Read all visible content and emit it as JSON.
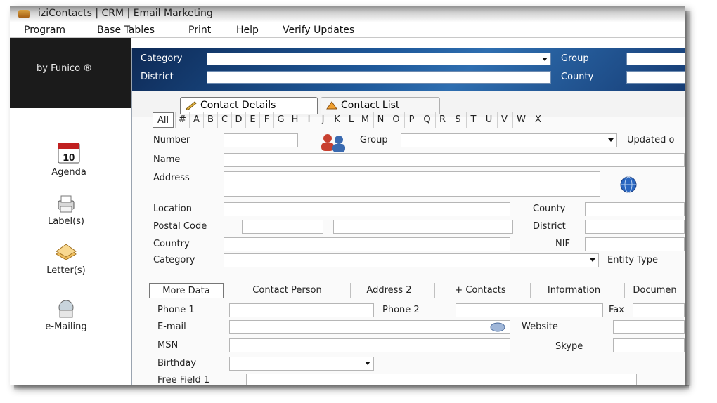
{
  "window": {
    "title": "iziContacts | CRM | Email Marketing"
  },
  "menu": [
    "Program",
    "Base Tables",
    "Print",
    "Help",
    "Verify Updates"
  ],
  "brand": "by Funico ®",
  "calendar_day": "10",
  "nav": [
    {
      "label": "Agenda",
      "icon": "calendar-icon"
    },
    {
      "label": "Label(s)",
      "icon": "label-printer-icon"
    },
    {
      "label": "Letter(s)",
      "icon": "letters-icon"
    },
    {
      "label": "e-Mailing",
      "icon": "mailing-icon"
    }
  ],
  "filters": {
    "category": "Category",
    "group": "Group",
    "district": "District",
    "county": "County"
  },
  "tabs": [
    "Contact Details",
    "Contact List"
  ],
  "alphabet": [
    "All",
    "#",
    "A",
    "B",
    "C",
    "D",
    "E",
    "F",
    "G",
    "H",
    "I",
    "J",
    "K",
    "L",
    "M",
    "N",
    "O",
    "P",
    "Q",
    "R",
    "S",
    "T",
    "U",
    "V",
    "W",
    "X"
  ],
  "form": {
    "number": "Number",
    "group": "Group",
    "updated": "Updated o",
    "name": "Name",
    "address": "Address",
    "location": "Location",
    "county": "County",
    "postal_code": "Postal Code",
    "district": "District",
    "country": "Country",
    "nif": "NIF",
    "category": "Category",
    "entity_type": "Entity Type"
  },
  "subtabs": [
    "More Data",
    "Contact Person",
    "Address 2",
    "+ Contacts",
    "Information",
    "Documen"
  ],
  "more_data": {
    "phone1": "Phone 1",
    "phone2": "Phone 2",
    "fax": "Fax",
    "email": "E-mail",
    "website": "Website",
    "msn": "MSN",
    "skype": "Skype",
    "birthday": "Birthday",
    "free_field": "Free Field 1"
  },
  "colors": {
    "header_blue": "#1f5a9c",
    "accent": "#0e2a56"
  }
}
